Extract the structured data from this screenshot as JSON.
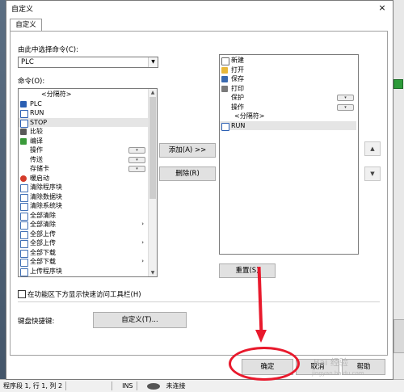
{
  "background": {
    "statusbar": {
      "position": "程序段 1, 行 1, 列 2",
      "mode": "INS",
      "connection": "未连接"
    }
  },
  "dialog": {
    "title": "自定义",
    "close": "×",
    "tab": "自定义",
    "choose_label": "由此中选择命令(C):",
    "category_value": "PLC",
    "commands_label": "命令(O):",
    "commands": [
      {
        "label": "<分隔符>",
        "icon": "none",
        "sep": true
      },
      {
        "label": "PLC",
        "icon": "plc-icon"
      },
      {
        "label": "RUN",
        "icon": "run-icon"
      },
      {
        "label": "STOP",
        "icon": "stop-icon",
        "selected": true
      },
      {
        "label": "比较",
        "icon": "compare-icon"
      },
      {
        "label": "编译",
        "icon": "compile-icon"
      },
      {
        "label": "操作",
        "icon": "none",
        "sub": true
      },
      {
        "label": "传送",
        "icon": "none",
        "sub": true
      },
      {
        "label": "存储卡",
        "icon": "none",
        "sub": true
      },
      {
        "label": "暖启动",
        "icon": "warm-start-icon"
      },
      {
        "label": "清除程序块",
        "icon": "doc-icon"
      },
      {
        "label": "清除数据块",
        "icon": "doc-icon"
      },
      {
        "label": "清除系统块",
        "icon": "doc-icon"
      },
      {
        "label": "全部清除",
        "icon": "doc-icon"
      },
      {
        "label": "全部清除",
        "icon": "doc-icon",
        "chevron": true
      },
      {
        "label": "全部上传",
        "icon": "doc-icon"
      },
      {
        "label": "全部上传",
        "icon": "doc-icon",
        "chevron": true
      },
      {
        "label": "全部下载",
        "icon": "doc-icon"
      },
      {
        "label": "全部下载",
        "icon": "doc-icon",
        "chevron": true
      },
      {
        "label": "上传程序块",
        "icon": "doc-icon"
      }
    ],
    "add_button": "添加(A) >>",
    "remove_button": "删除(R)",
    "toolbar_items": [
      {
        "label": "新建",
        "icon": "new-icon"
      },
      {
        "label": "打开",
        "icon": "open-icon"
      },
      {
        "label": "保存",
        "icon": "save-icon"
      },
      {
        "label": "打印",
        "icon": "print-icon"
      },
      {
        "label": "保护",
        "icon": "none",
        "sub": true
      },
      {
        "label": "操作",
        "icon": "none",
        "sub": true
      },
      {
        "label": "<分隔符>",
        "icon": "none",
        "sep": true
      },
      {
        "label": "RUN",
        "icon": "run-icon",
        "selected": true
      }
    ],
    "move_up": "▲",
    "move_down": "▼",
    "reset_button": "重置(S)",
    "show_below_label": "在功能区下方显示快速访问工具栏(H)",
    "keyboard_label": "键盘快捷键:",
    "customize_button": "自定义(T)...",
    "ok_button": "确定",
    "cancel_button": "取消",
    "help_button": "帮助"
  },
  "watermark": {
    "text": "Bai 经验",
    "url": "jingyan.baidu.com"
  },
  "colors": {
    "annotation": "#e8192c",
    "selection": "#e5e5e5",
    "button": "#e1e1e1"
  }
}
